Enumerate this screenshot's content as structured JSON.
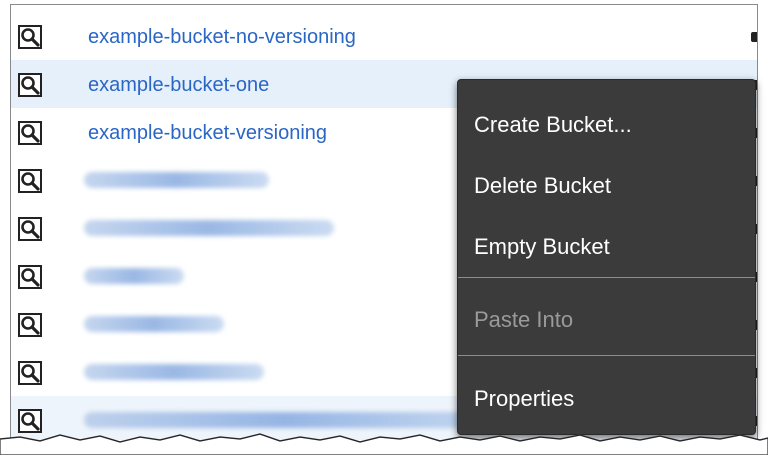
{
  "buckets": [
    {
      "name": "example-bucket-no-versioning"
    },
    {
      "name": "example-bucket-one"
    },
    {
      "name": "example-bucket-versioning"
    }
  ],
  "context_menu": {
    "items": [
      {
        "label": "Create Bucket...",
        "enabled": true
      },
      {
        "label": "Delete Bucket",
        "enabled": true
      },
      {
        "label": "Empty Bucket",
        "enabled": true
      },
      {
        "label": "Paste Into",
        "enabled": false
      },
      {
        "label": "Properties",
        "enabled": true
      }
    ]
  },
  "icons": {
    "row_icon": "magnifier-icon"
  },
  "colors": {
    "link": "#2a66c4",
    "selected_row": "#e5f0fb",
    "menu_bg": "#3b3b3b",
    "menu_text": "#ffffff",
    "menu_disabled": "#9a9a9a"
  }
}
